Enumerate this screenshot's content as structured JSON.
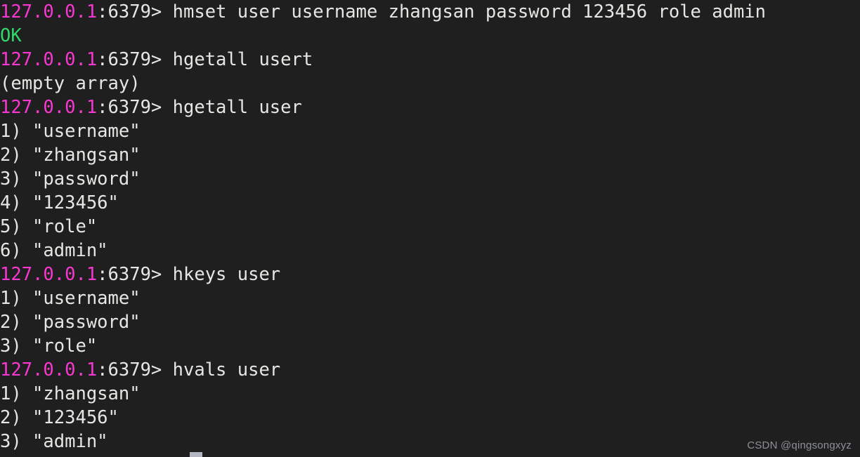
{
  "terminal": {
    "background_color": "#1f1f1f",
    "foreground_color": "#e8e6e3",
    "host_color": "#f838d0",
    "ok_color": "#2fd96b",
    "cursor_color": "#b3b6c0",
    "prompt_host": "127.0.0.1",
    "prompt_port": ":6379> ",
    "lines": [
      {
        "type": "prompt",
        "command": "hmset user username zhangsan password 123456 role admin"
      },
      {
        "type": "status",
        "text": "OK"
      },
      {
        "type": "prompt",
        "command": "hgetall usert"
      },
      {
        "type": "output",
        "text": "(empty array)"
      },
      {
        "type": "prompt",
        "command": "hgetall user"
      },
      {
        "type": "output",
        "text": "1) \"username\""
      },
      {
        "type": "output",
        "text": "2) \"zhangsan\""
      },
      {
        "type": "output",
        "text": "3) \"password\""
      },
      {
        "type": "output",
        "text": "4) \"123456\""
      },
      {
        "type": "output",
        "text": "5) \"role\""
      },
      {
        "type": "output",
        "text": "6) \"admin\""
      },
      {
        "type": "prompt",
        "command": "hkeys user"
      },
      {
        "type": "output",
        "text": "1) \"username\""
      },
      {
        "type": "output",
        "text": "2) \"password\""
      },
      {
        "type": "output",
        "text": "3) \"role\""
      },
      {
        "type": "prompt",
        "command": "hvals user"
      },
      {
        "type": "output",
        "text": "1) \"zhangsan\""
      },
      {
        "type": "output",
        "text": "2) \"123456\""
      },
      {
        "type": "output",
        "text": "3) \"admin\""
      }
    ]
  },
  "watermark": {
    "text": "CSDN @qingsongxyz"
  }
}
